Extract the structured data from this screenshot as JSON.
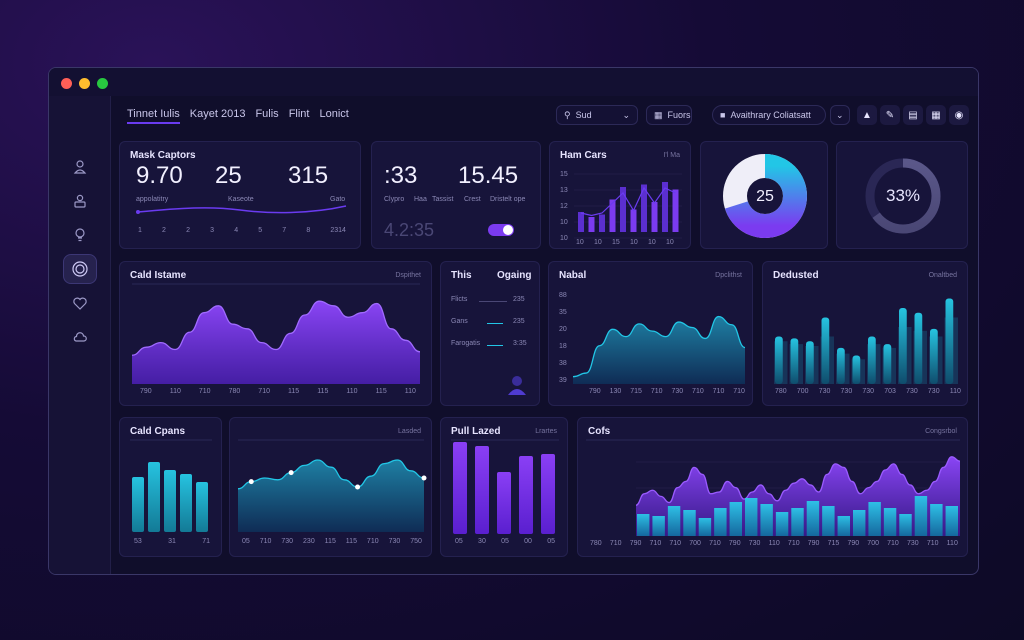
{
  "window": {
    "controls": [
      "close",
      "minimize",
      "zoom"
    ],
    "colors": {
      "close": "#ff5f57",
      "minimize": "#febc2e",
      "zoom": "#28c840"
    }
  },
  "sidebar": {
    "items": [
      {
        "name": "user-icon"
      },
      {
        "name": "profile-icon"
      },
      {
        "name": "lightbulb-icon"
      },
      {
        "name": "target-icon",
        "active": true
      },
      {
        "name": "heart-icon"
      },
      {
        "name": "cloud-icon"
      }
    ]
  },
  "nav": {
    "tabs": [
      {
        "label": "Tinnet Iulis",
        "active": true
      },
      {
        "label": "Kayet 2013"
      },
      {
        "label": "Fulis"
      },
      {
        "label": "Flint"
      },
      {
        "label": "Lonict"
      }
    ]
  },
  "toolbar": {
    "search_value": "Sud",
    "filter_label": "Fuors",
    "account_label": "Avaithrary Coliatsatt",
    "buttons": [
      "image-icon",
      "pencil-icon",
      "document-icon",
      "calendar-icon",
      "globe-icon"
    ]
  },
  "colors": {
    "purple": "#7b3bf0",
    "cyan": "#22c6e6",
    "teal": "#1c6e8c",
    "card": "#17143a"
  },
  "card1": {
    "title": "Mask Captors",
    "stats": [
      "9.70",
      "25",
      "315"
    ],
    "label_a": "appolatitry",
    "label_b": "Kaseote",
    "label_c": "Gato",
    "ticks": [
      "1",
      "2",
      "2",
      "3",
      "4",
      "5",
      "7",
      "8",
      "2314"
    ]
  },
  "card2": {
    "stats": [
      ":33",
      "15.45"
    ],
    "labels": [
      "Clypro",
      "Haa",
      "Tassist",
      "Crest",
      "Dristelt ope"
    ],
    "faded_value": "4.2:35",
    "toggle_on": true
  },
  "card3": {
    "title": "Ham Cars",
    "sub": "I'l Ma",
    "yticks": [
      "15",
      "13",
      "12",
      "10",
      "10"
    ],
    "xticks": [
      "10",
      "10",
      "15",
      "10",
      "10",
      "10"
    ],
    "chart_data": {
      "type": "bar",
      "series": [
        {
          "values": [
            0.4,
            0.3,
            0.35,
            0.65,
            0.9,
            0.45,
            0.95,
            0.6,
            1.0,
            0.85
          ]
        },
        {
          "values": [
            0.3,
            0.25,
            0.3,
            0.5,
            0.7,
            0.35,
            0.8,
            0.5,
            0.8,
            0.7
          ]
        }
      ]
    }
  },
  "donut1": {
    "value": "25",
    "fill": 0.7
  },
  "donut2": {
    "value": "33%",
    "fill": 0.65
  },
  "card4": {
    "title": "Cald Istame",
    "sub": "Dspithet",
    "xticks": [
      "790",
      "110",
      "710",
      "780",
      "710",
      "115",
      "115",
      "110",
      "115",
      "110"
    ],
    "chart_data": {
      "type": "area",
      "values": [
        25,
        32,
        36,
        30,
        45,
        62,
        68,
        52,
        48,
        36,
        30,
        44,
        60,
        72,
        68,
        58,
        62,
        70,
        48,
        38,
        28
      ]
    }
  },
  "card5": {
    "title": "This",
    "title2": "Ogaing",
    "rows": [
      {
        "label": "Flicts",
        "value": "235"
      },
      {
        "label": "Gans",
        "value": "235"
      },
      {
        "label": "Farogatis",
        "value": "3:35"
      }
    ]
  },
  "card6": {
    "title": "Nabal",
    "sub": "Dpclithst",
    "yticks": [
      "88",
      "35",
      "20",
      "18",
      "38",
      "39"
    ],
    "xticks": [
      "790",
      "130",
      "715",
      "710",
      "730",
      "710",
      "710",
      "710"
    ],
    "chart_data": {
      "type": "area",
      "values": [
        8,
        12,
        42,
        60,
        52,
        66,
        58,
        52,
        68,
        62,
        50,
        74,
        65,
        40
      ]
    }
  },
  "card7": {
    "title": "Dedusted",
    "sub": "Onaltbed",
    "xticks": [
      "780",
      "700",
      "730",
      "730",
      "730",
      "703",
      "730",
      "730",
      "110"
    ],
    "chart_data": {
      "type": "bar",
      "values": [
        50,
        48,
        45,
        70,
        38,
        30,
        50,
        42,
        80,
        75,
        58,
        90
      ],
      "shadow": [
        45,
        42,
        40,
        50,
        32,
        26,
        42,
        38,
        60,
        56,
        50,
        70
      ]
    }
  },
  "card8": {
    "title": "Cald Cpans",
    "xticks": [
      "53",
      "31",
      "71"
    ],
    "chart_data": {
      "type": "bar",
      "values": [
        55,
        70,
        62,
        58,
        50
      ]
    }
  },
  "card9": {
    "title": "",
    "sub": "Lasded",
    "xticks": [
      "05",
      "710",
      "730",
      "230",
      "115",
      "115",
      "710",
      "730",
      "750"
    ],
    "chart_data": {
      "type": "area",
      "values": [
        48,
        56,
        60,
        58,
        66,
        74,
        80,
        72,
        58,
        50,
        62,
        76,
        80,
        68,
        60
      ],
      "points": [
        1,
        4,
        9,
        14
      ]
    }
  },
  "card10": {
    "title": "Pull Lazed",
    "sub": "Lrartes",
    "xticks": [
      "05",
      "30",
      "05",
      "00",
      "05"
    ],
    "chart_data": {
      "type": "bar",
      "values": [
        92,
        88,
        62,
        78,
        80
      ]
    }
  },
  "card11": {
    "title": "Cofs",
    "sub": "Congsrbol",
    "xticks": [
      "780",
      "710",
      "790",
      "710",
      "710",
      "700",
      "710",
      "790",
      "730",
      "110",
      "710",
      "790",
      "715",
      "790",
      "700",
      "710",
      "730",
      "710",
      "110"
    ],
    "chart_data": {
      "type": "area",
      "values": [
        35,
        48,
        52,
        45,
        38,
        55,
        62,
        78,
        70,
        48,
        50,
        62,
        55,
        42,
        50,
        58,
        48,
        40,
        52,
        60,
        65,
        58,
        50,
        70,
        82,
        78,
        62,
        48,
        55,
        62,
        75,
        82,
        70,
        58,
        48,
        52,
        62,
        78,
        90,
        85
      ],
      "bars": [
        22,
        20,
        30,
        26,
        18,
        28,
        34,
        38,
        32,
        24,
        28,
        35,
        30,
        20,
        26,
        34,
        28,
        22,
        40,
        32,
        30
      ]
    }
  }
}
